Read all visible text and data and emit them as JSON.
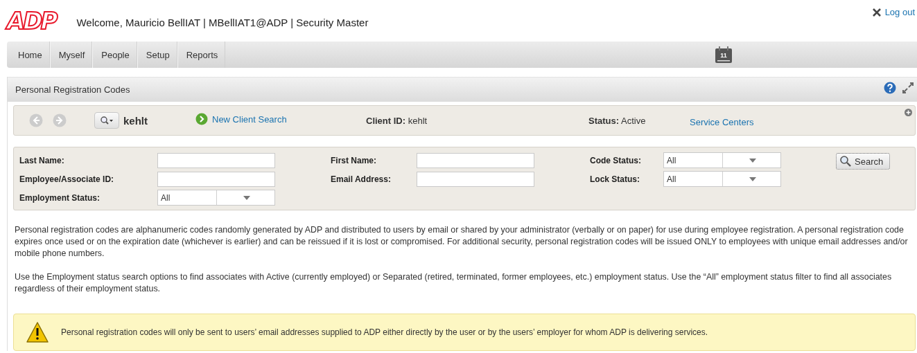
{
  "header": {
    "logo": "ADP",
    "welcome": "Welcome, Mauricio BellIAT | MBellIAT1@ADP | Security Master",
    "logout": "Log out"
  },
  "nav": {
    "items": [
      "Home",
      "Myself",
      "People",
      "Setup",
      "Reports"
    ],
    "calendar_day": "11"
  },
  "panel": {
    "title": "Personal Registration Codes",
    "client_bar": {
      "client_name": "kehlt",
      "new_search": "New Client Search",
      "client_id_label": "Client ID:",
      "client_id": "kehlt",
      "status_label": "Status:",
      "status": "Active",
      "service_centers": "Service Centers"
    },
    "search_form": {
      "fields": [
        {
          "label": "Last Name:",
          "kind": "text"
        },
        {
          "label": "First Name:",
          "kind": "text"
        },
        {
          "label": "Code Status:",
          "kind": "select",
          "value": "All"
        },
        {
          "label": "Employee/Associate ID:",
          "kind": "text"
        },
        {
          "label": "Email Address:",
          "kind": "text"
        },
        {
          "label": "Lock Status:",
          "kind": "select",
          "value": "All"
        },
        {
          "label": "Employment Status:",
          "kind": "select",
          "value": "All"
        }
      ],
      "search_button": "Search"
    },
    "paragraphs": [
      "Personal registration codes are alphanumeric codes randomly generated by ADP and distributed to users by email or shared by your administrator (verbally or on paper) for use during employee registration. A personal registration code expires once used or on the expiration date (whichever is earlier) and can be reissued if it is lost or compromised. For additional security, personal registration codes will be issued ONLY to employees with unique email addresses and/or mobile phone numbers.",
      "Use the Employment status search options to find associates with Active (currently employed) or Separated (retired, terminated, former employees, etc.) employment status. Use the “All” employment status filter to find all associates regardless of their employment status."
    ],
    "warning": "Personal registration codes will only be sent to users’ email addresses supplied to ADP either directly by the user or by the users’ employer for whom ADP is delivering services."
  }
}
